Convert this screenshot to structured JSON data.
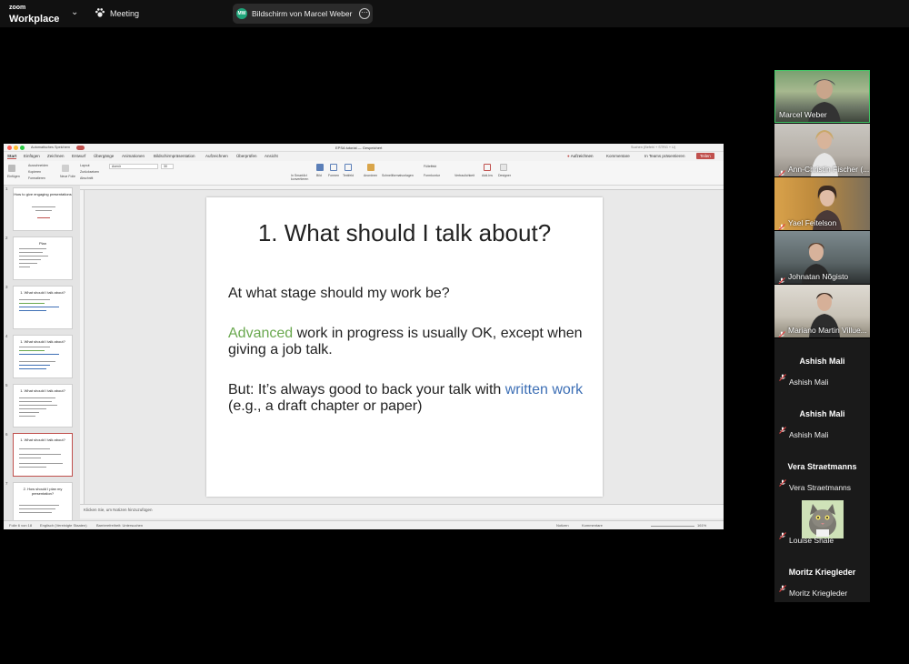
{
  "zoom": {
    "brand_small": "zoom",
    "brand_large": "Workplace",
    "chevron": "⌄",
    "meeting_label": "Meeting",
    "share_initials": "MW",
    "share_label": "Bildschirm von Marcel Weber",
    "share_more": "⋯"
  },
  "ppt": {
    "autosave_label": "Automatisches Speichern",
    "doc_title": "EPSA tutorial — Gespeichert",
    "search_placeholder": "Suchen (Befehl + STRG + U)",
    "tabs": [
      "Start",
      "Einfügen",
      "Zeichnen",
      "Entwurf",
      "Übergänge",
      "Animationen",
      "Bildschirmpräsentation",
      "Aufzeichnen",
      "Überprüfen",
      "Ansicht"
    ],
    "record_label": "Aufzeichnen",
    "comments_label": "Kommentare",
    "teams_label": "In Teams präsentieren",
    "share_label": "Teilen",
    "ribbon": {
      "paste": "Einfügen",
      "cut": "Ausschneiden",
      "copy": "Kopieren",
      "format": "Formatieren",
      "new_slide": "Neue Folie",
      "layout": "Layout",
      "reset": "Zurücksetzen",
      "section": "Abschnitt",
      "picture": "Bild",
      "shapes": "Formen",
      "textbox": "Textfeld",
      "arrange": "Anordnen",
      "quick_styles": "Schnellformatvorlagen",
      "add_ins": "Add-Ins",
      "designer": "Designer",
      "fill": "Fülleffekt",
      "outline": "Formkontur",
      "smartart": "In SmartArt konvertieren",
      "dictate": "Vertraulichkeit",
      "font": "Avenir",
      "size": "30"
    },
    "thumbs": [
      {
        "num": "1",
        "title": "How to give engaging presentations"
      },
      {
        "num": "2",
        "title": "Plan"
      },
      {
        "num": "3",
        "title": "1. What should I talk about?"
      },
      {
        "num": "4",
        "title": "1. What should I talk about?"
      },
      {
        "num": "5",
        "title": "1. What should I talk about?"
      },
      {
        "num": "6",
        "title": "1. What should I talk about?"
      },
      {
        "num": "7",
        "title": "2. How should I plan my presentation?"
      }
    ],
    "notes_placeholder": "Klicken Sie, um Notizen hinzuzufügen",
    "status": {
      "slide_of": "Folie 6 von 18",
      "language": "Englisch (Vereinigte Staaten)",
      "accessibility": "Barrierefreiheit: Untersuchen",
      "notes": "Notizen",
      "comments": "Kommentare",
      "zoom": "161%"
    }
  },
  "slide": {
    "title": "1. What should I talk about?",
    "p1": "At what stage should my work be?",
    "p2_highlight": "Advanced",
    "p2_rest": " work in progress is usually OK, except when giving a job talk.",
    "p3_start": "But: It’s always good to back your talk with ",
    "p3_highlight": "written work",
    "p3_end": " (e.g., a draft chapter or paper)",
    "colors": {
      "green": "#6aa84f",
      "blue": "#3d6fb5"
    }
  },
  "participants": [
    {
      "name": "Marcel Weber",
      "video": true,
      "speaking": true
    },
    {
      "name": "Ann-Christin Fischer (...",
      "video": true
    },
    {
      "name": "Yael Feitelson",
      "video": true
    },
    {
      "name": "Johnatan Nõgisto",
      "video": true
    },
    {
      "name": "Mariano Martin Villue...",
      "video": true
    },
    {
      "name": "Ashish Mali",
      "display": "Ashish Mali",
      "video": false
    },
    {
      "name": "Ashish Mali",
      "display": "Ashish Mali",
      "video": false
    },
    {
      "name": "Vera Straetmanns",
      "display": "Vera Straetmanns",
      "video": false
    },
    {
      "name": "Louise Shale",
      "video": false,
      "avatar": true
    },
    {
      "name": "Moritz Kriegleder",
      "display": "Moritz Kriegleder",
      "video": false
    }
  ]
}
